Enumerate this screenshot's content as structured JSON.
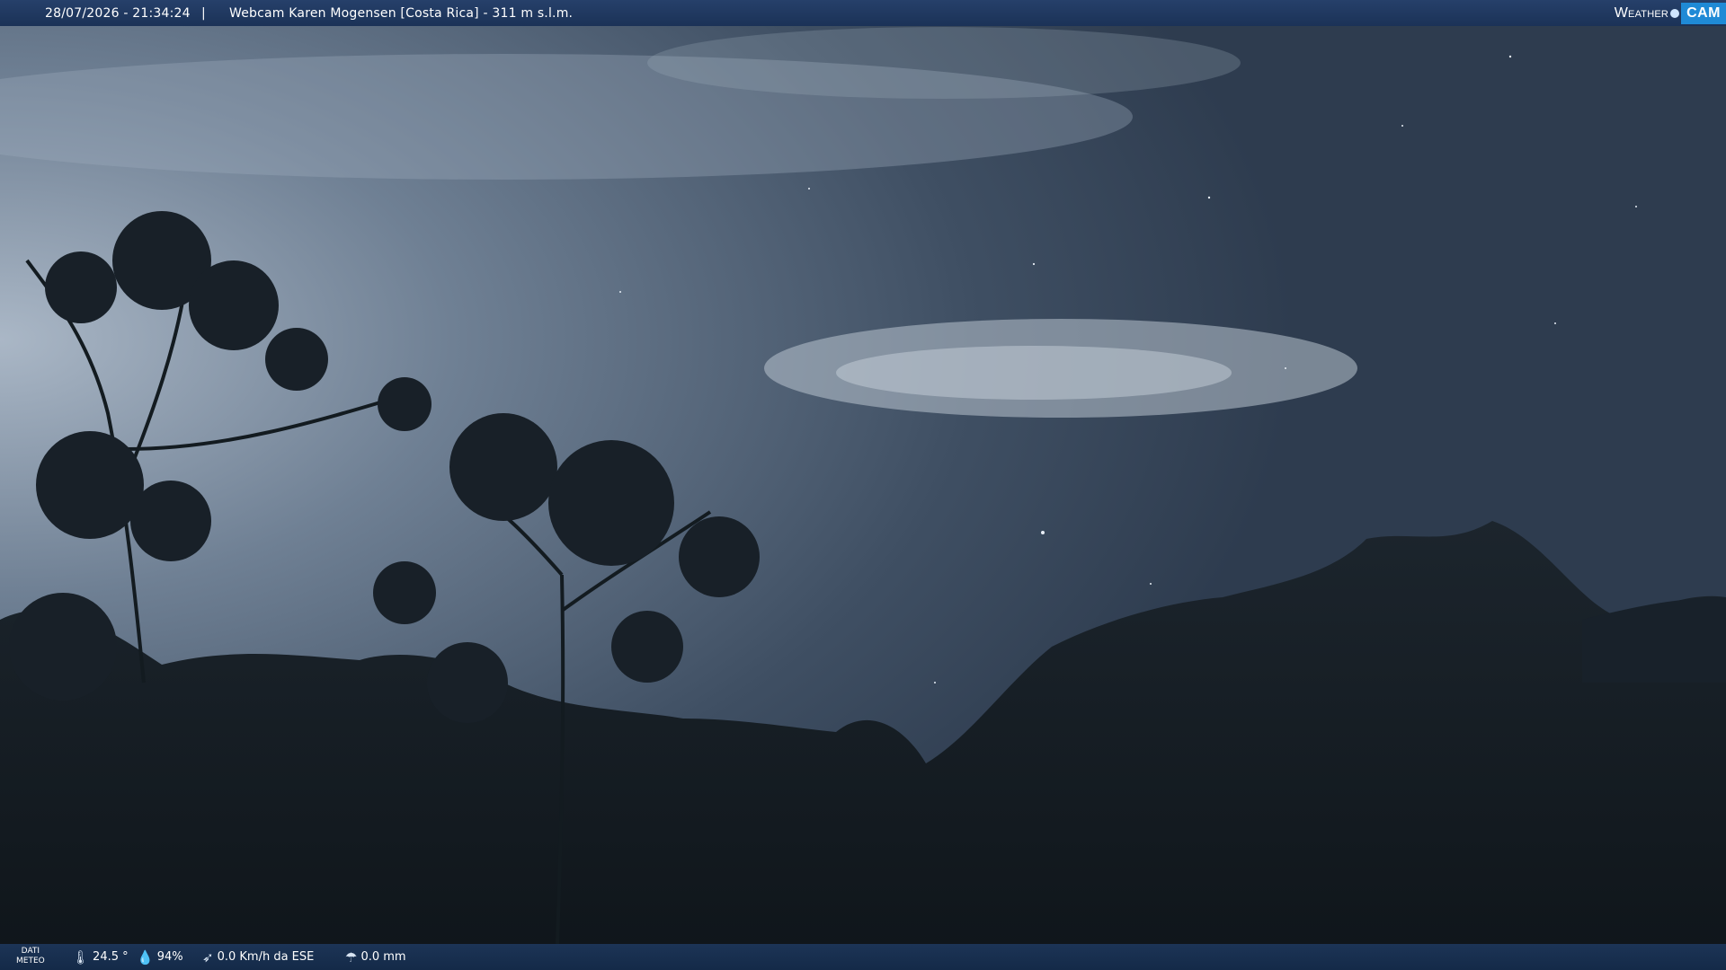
{
  "header": {
    "timestamp": "28/07/2026 - 21:34:24",
    "separator": "|",
    "title": "Webcam Karen Mogensen [Costa Rica] - 311 m s.l.m.",
    "logo_text": "Weather",
    "logo_badge": "CAM"
  },
  "footer": {
    "dati_line1": "DATI",
    "dati_line2": "METEO",
    "temperature": "24.5 °",
    "humidity": "94%",
    "wind": "0.0 Km/h da ESE",
    "rain": "0.0 mm",
    "icons": [
      "thermometer-icon",
      "humidity-drop-icon",
      "wind-icon",
      "rain-gauge-icon"
    ]
  },
  "colors": {
    "sky_top": "#3a4a5e",
    "sky_glow": "#9aa9bb",
    "foliage": "#141c22",
    "bar": "#1c3456",
    "logo_accent": "#1f8ad6"
  }
}
